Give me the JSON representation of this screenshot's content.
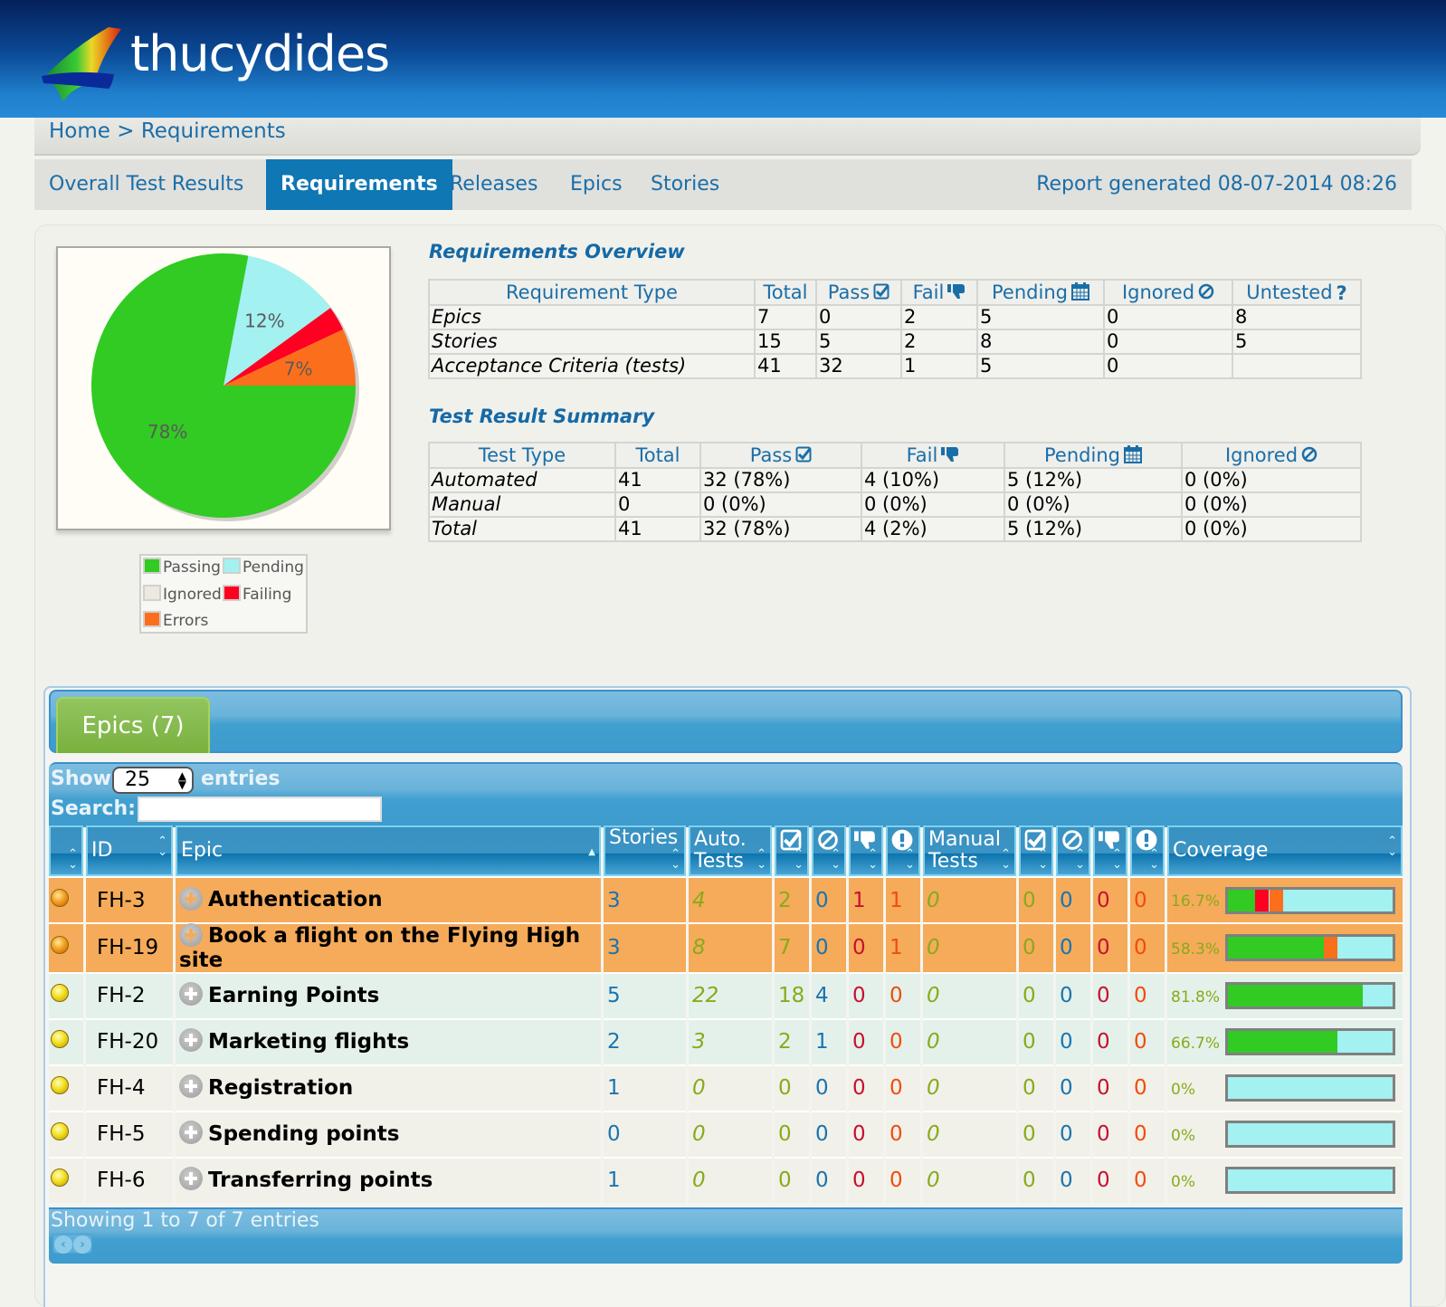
{
  "header": {
    "app_name": "thucydides"
  },
  "breadcrumb": {
    "text": "Home > Requirements"
  },
  "tabs": [
    {
      "label": "Overall Test Results",
      "active": false
    },
    {
      "label": "Requirements",
      "active": true
    },
    {
      "label": "Releases",
      "active": false
    },
    {
      "label": "Epics",
      "active": false
    },
    {
      "label": "Stories",
      "active": false
    }
  ],
  "report_generated": "Report generated 08-07-2014 08:26",
  "colors": {
    "passing": "#31cb23",
    "pending": "#a3f1f1",
    "ignored": "#ede9e2",
    "failing": "#ff0022",
    "errors": "#fb6f1c",
    "accent": "#0e77b4"
  },
  "chart_data": {
    "type": "pie",
    "title": "",
    "slices": [
      {
        "label": "Errors",
        "value": 7,
        "display": "7%"
      },
      {
        "label": "Failing",
        "value": 3,
        "display": ""
      },
      {
        "label": "Pending",
        "value": 12,
        "display": "12%"
      },
      {
        "label": "Passing",
        "value": 78,
        "display": "78%"
      }
    ],
    "legend": [
      "Passing",
      "Pending",
      "Ignored",
      "Failing",
      "Errors"
    ],
    "legend_position": "bottom"
  },
  "requirements_overview": {
    "title": "Requirements Overview",
    "headers": [
      "Requirement Type",
      "Total",
      "Pass",
      "Fail",
      "Pending",
      "Ignored",
      "Untested"
    ],
    "rows": [
      [
        "Epics",
        "7",
        "0",
        "2",
        "5",
        "0",
        "8"
      ],
      [
        "Stories",
        "15",
        "5",
        "2",
        "8",
        "0",
        "5"
      ],
      [
        "Acceptance Criteria (tests)",
        "41",
        "32",
        "1",
        "5",
        "0",
        ""
      ]
    ]
  },
  "test_result_summary": {
    "title": "Test Result Summary",
    "headers": [
      "Test Type",
      "Total",
      "Pass",
      "Fail",
      "Pending",
      "Ignored"
    ],
    "rows": [
      [
        "Automated",
        "41",
        "32 (78%)",
        "4 (10%)",
        "5 (12%)",
        "0 (0%)"
      ],
      [
        "Manual",
        "0",
        "0 (0%)",
        "0 (0%)",
        "0 (0%)",
        "0 (0%)"
      ],
      [
        "Total",
        "41",
        "32 (78%)",
        "4 (2%)",
        "5 (12%)",
        "0 (0%)"
      ]
    ]
  },
  "epics": {
    "tab_label": "Epics (7)",
    "show_label": "Show",
    "entries_label": "entries",
    "page_size": "25",
    "search_label": "Search:",
    "search_value": "",
    "headers": {
      "id": "ID",
      "epic": "Epic",
      "stories": "Stories",
      "auto_tests_1": "Auto.",
      "auto_tests_2": "Tests",
      "manual_tests_1": "Manual",
      "manual_tests_2": "Tests",
      "coverage": "Coverage"
    },
    "rows": [
      {
        "status": "orange",
        "id": "FH-3",
        "name": "Authentication",
        "stories": "3",
        "auto": "4",
        "a_pass": "2",
        "a_ign": "0",
        "a_fail": "1",
        "a_err": "1",
        "manual": "0",
        "m_pass": "0",
        "m_ign": "0",
        "m_fail": "0",
        "m_err": "0",
        "coverage": "16.7%",
        "bar": {
          "passing": 16.7,
          "failing": 8.3,
          "errors": 8.3
        }
      },
      {
        "status": "orange",
        "id": "FH-19",
        "name": "Book a flight on the Flying High site",
        "stories": "3",
        "auto": "8",
        "a_pass": "7",
        "a_ign": "0",
        "a_fail": "0",
        "a_err": "1",
        "manual": "0",
        "m_pass": "0",
        "m_ign": "0",
        "m_fail": "0",
        "m_err": "0",
        "coverage": "58.3%",
        "bar": {
          "passing": 58.3,
          "failing": 0,
          "errors": 8.3
        }
      },
      {
        "status": "yellow",
        "id": "FH-2",
        "name": "Earning Points",
        "stories": "5",
        "auto": "22",
        "a_pass": "18",
        "a_ign": "4",
        "a_fail": "0",
        "a_err": "0",
        "manual": "0",
        "m_pass": "0",
        "m_ign": "0",
        "m_fail": "0",
        "m_err": "0",
        "coverage": "81.8%",
        "bar": {
          "passing": 81.8,
          "failing": 0,
          "errors": 0
        }
      },
      {
        "status": "yellow",
        "id": "FH-20",
        "name": "Marketing flights",
        "stories": "2",
        "auto": "3",
        "a_pass": "2",
        "a_ign": "1",
        "a_fail": "0",
        "a_err": "0",
        "manual": "0",
        "m_pass": "0",
        "m_ign": "0",
        "m_fail": "0",
        "m_err": "0",
        "coverage": "66.7%",
        "bar": {
          "passing": 66.7,
          "failing": 0,
          "errors": 0
        }
      },
      {
        "status": "yellow",
        "id": "FH-4",
        "name": "Registration",
        "stories": "1",
        "auto": "0",
        "a_pass": "0",
        "a_ign": "0",
        "a_fail": "0",
        "a_err": "0",
        "manual": "0",
        "m_pass": "0",
        "m_ign": "0",
        "m_fail": "0",
        "m_err": "0",
        "coverage": "0%",
        "bar": {
          "passing": 0,
          "failing": 0,
          "errors": 0
        }
      },
      {
        "status": "yellow",
        "id": "FH-5",
        "name": "Spending points",
        "stories": "0",
        "auto": "0",
        "a_pass": "0",
        "a_ign": "0",
        "a_fail": "0",
        "a_err": "0",
        "manual": "0",
        "m_pass": "0",
        "m_ign": "0",
        "m_fail": "0",
        "m_err": "0",
        "coverage": "0%",
        "bar": {
          "passing": 0,
          "failing": 0,
          "errors": 0
        }
      },
      {
        "status": "yellow",
        "id": "FH-6",
        "name": "Transferring points",
        "stories": "1",
        "auto": "0",
        "a_pass": "0",
        "a_ign": "0",
        "a_fail": "0",
        "a_err": "0",
        "manual": "0",
        "m_pass": "0",
        "m_ign": "0",
        "m_fail": "0",
        "m_err": "0",
        "coverage": "0%",
        "bar": {
          "passing": 0,
          "failing": 0,
          "errors": 0
        }
      }
    ],
    "footer": "Showing 1 to 7 of 7 entries"
  }
}
